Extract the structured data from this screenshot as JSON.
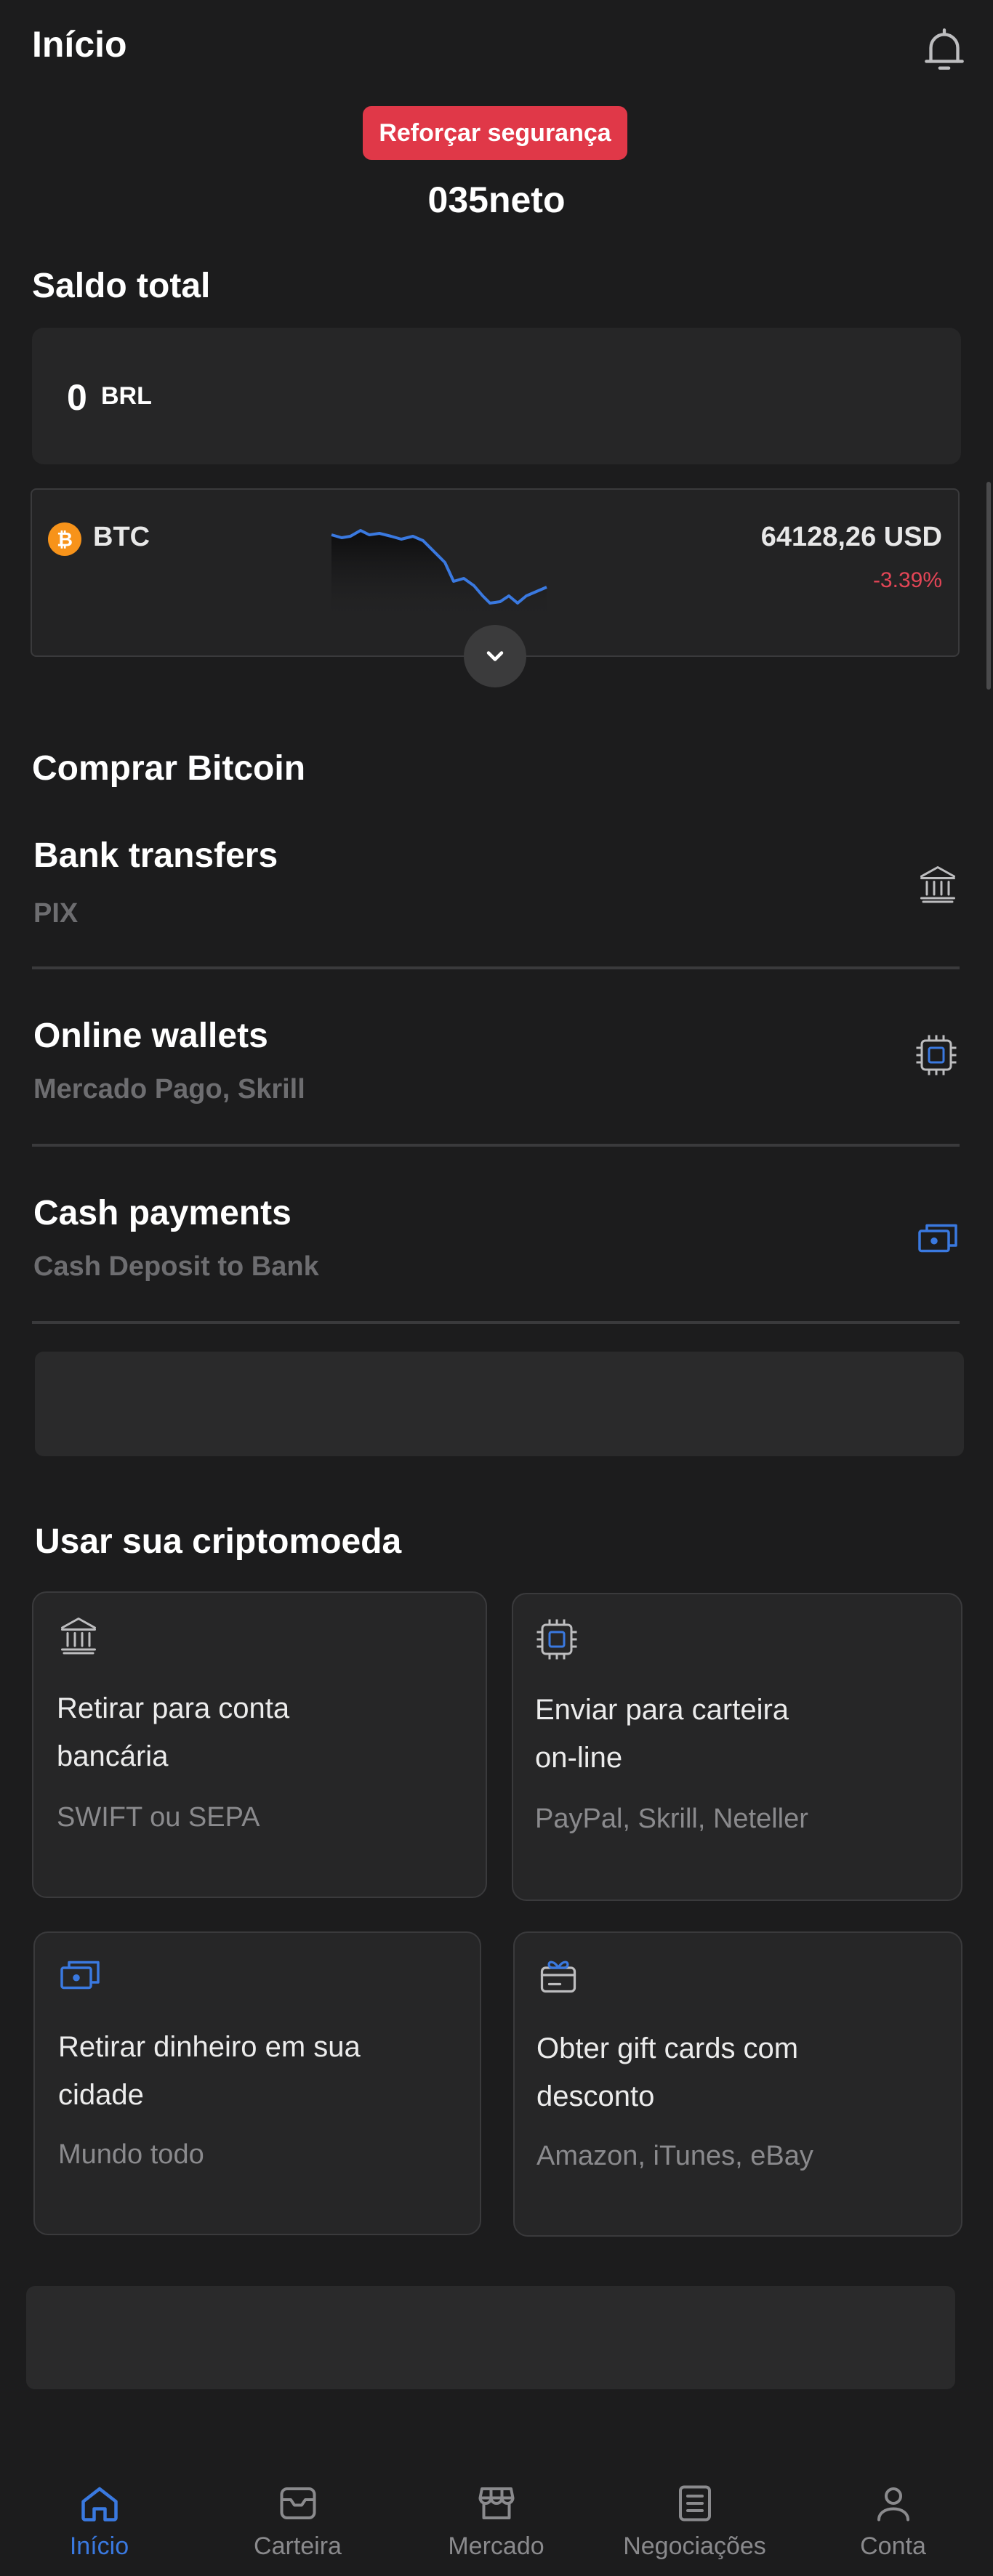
{
  "header": {
    "title": "Início",
    "security_badge": "Reforçar segurança",
    "username": "035neto"
  },
  "balance": {
    "section_title": "Saldo total",
    "value": "0",
    "currency": "BRL"
  },
  "asset": {
    "symbol": "BTC",
    "price": "64128,26 USD",
    "change": "-3.39%",
    "change_color": "#e34556",
    "line_color": "#3a79e0"
  },
  "buy": {
    "section_title": "Comprar Bitcoin",
    "methods": [
      {
        "title": "Bank transfers",
        "subtitle": "PIX",
        "icon": "bank-icon"
      },
      {
        "title": "Online wallets",
        "subtitle": "Mercado Pago, Skrill",
        "icon": "chip-icon"
      },
      {
        "title": "Cash payments",
        "subtitle": "Cash Deposit to Bank",
        "icon": "cash-icon"
      }
    ]
  },
  "use": {
    "section_title": "Usar sua criptomoeda",
    "tiles": [
      {
        "title_line1": "Retirar para conta",
        "title_line2": "bancária",
        "subtitle": "SWIFT ou SEPA",
        "icon": "bank-icon"
      },
      {
        "title_line1": "Enviar para carteira",
        "title_line2": "on-line",
        "subtitle": "PayPal, Skrill, Neteller",
        "icon": "chip-icon"
      },
      {
        "title_line1": "Retirar dinheiro em sua",
        "title_line2": "cidade",
        "subtitle": "Mundo todo",
        "icon": "cash-icon"
      },
      {
        "title_line1": "Obter gift cards com",
        "title_line2": "desconto",
        "subtitle": "Amazon, iTunes, eBay",
        "icon": "gift-card-icon"
      }
    ]
  },
  "nav": {
    "items": [
      {
        "label": "Início",
        "icon": "home-icon",
        "active": true
      },
      {
        "label": "Carteira",
        "icon": "wallet-icon",
        "active": false
      },
      {
        "label": "Mercado",
        "icon": "market-icon",
        "active": false
      },
      {
        "label": "Negociações",
        "icon": "trades-icon",
        "active": false
      },
      {
        "label": "Conta",
        "icon": "account-icon",
        "active": false
      }
    ]
  },
  "colors": {
    "accent": "#3a79e0",
    "danger": "#e03848",
    "background": "#1c1c1d",
    "card": "#262627",
    "btc": "#f7931a"
  }
}
